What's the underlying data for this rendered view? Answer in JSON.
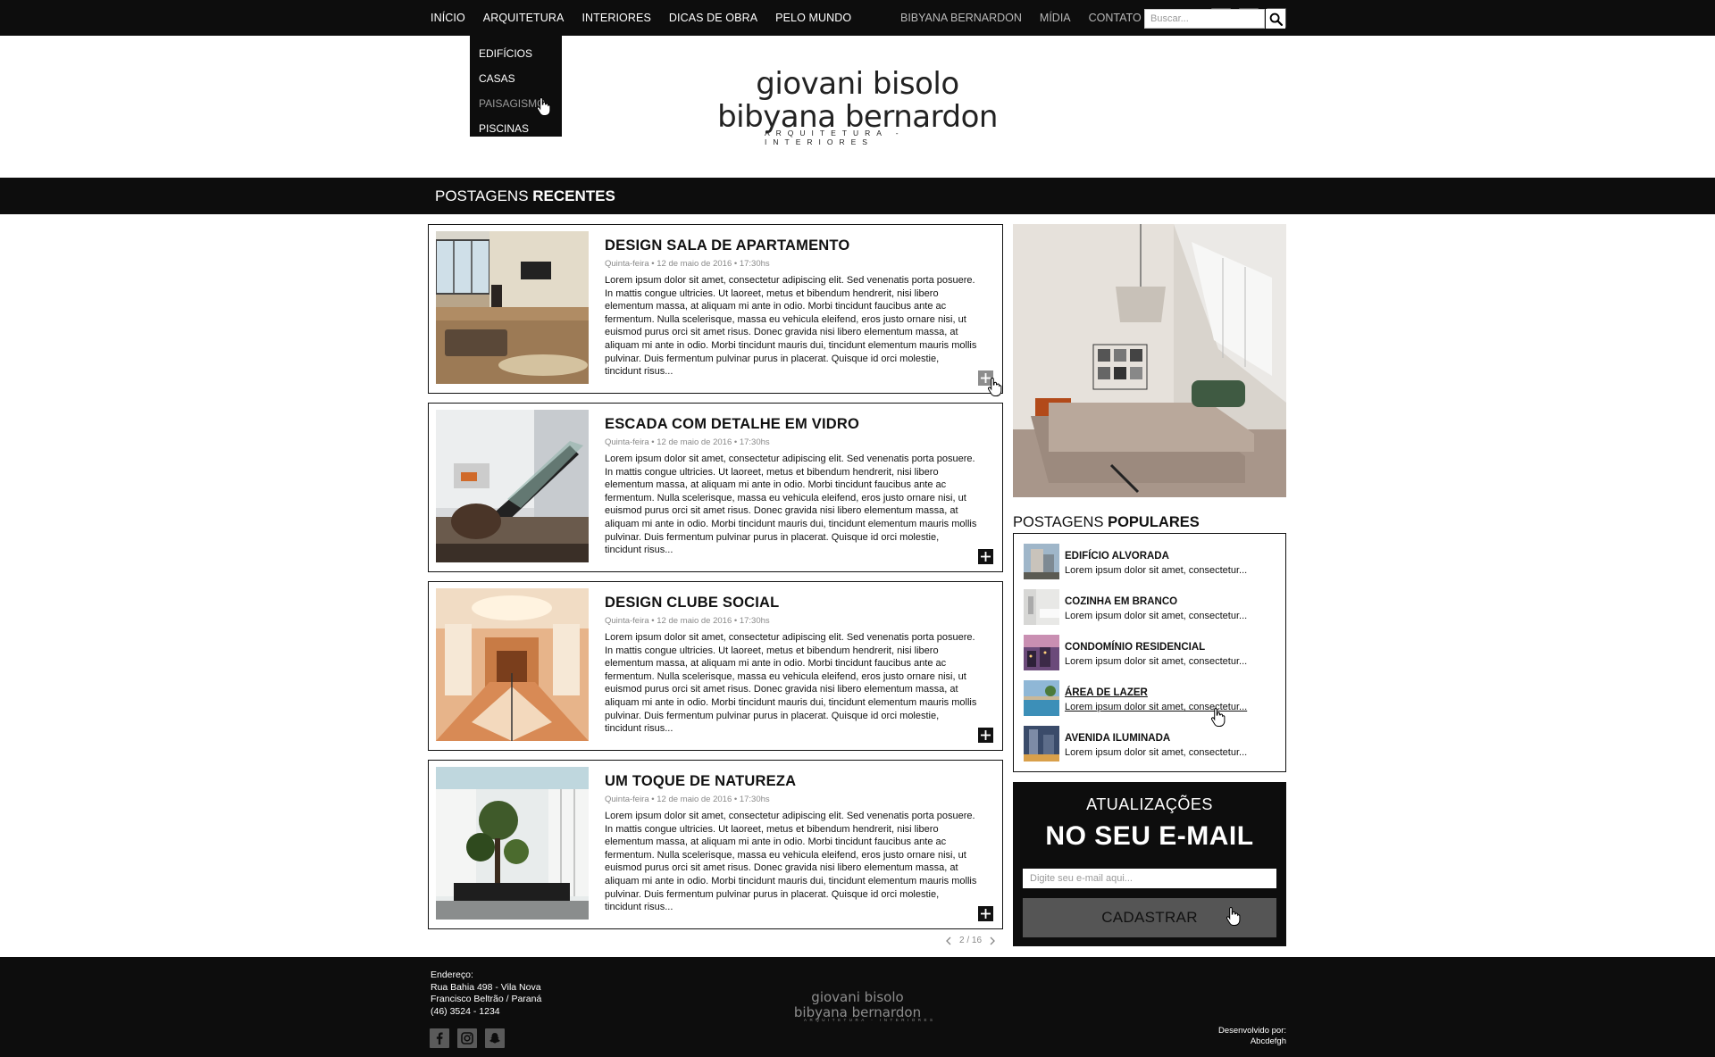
{
  "nav": {
    "main": [
      "INÍCIO",
      "ARQUITETURA",
      "INTERIORES",
      "DICAS DE OBRA",
      "PELO MUNDO"
    ],
    "secondary": [
      "BIBYANA BERNARDON",
      "MÍDIA",
      "CONTATO"
    ],
    "social": [
      "facebook-icon",
      "instagram-icon",
      "snapchat-icon"
    ]
  },
  "dropdown": {
    "items": [
      "EDIFÍCIOS",
      "CASAS",
      "PAISAGISMO",
      "PISCINAS"
    ],
    "hovered": "PAISAGISMO"
  },
  "logo": {
    "line1": "giovani bisolo",
    "line2": "bibyana bernardon",
    "tagline": "ARQUITETURA - INTERIORES"
  },
  "section": {
    "title_light": "POSTAGENS ",
    "title_bold": "RECENTES",
    "search_placeholder": "Buscar..."
  },
  "posts": [
    {
      "title": "DESIGN SALA DE APARTAMENTO",
      "date": "Quinta-feira • 12 de maio de 2016 • 17:30hs",
      "excerpt": "Lorem ipsum dolor sit amet, consectetur adipiscing elit. Sed venenatis porta posuere. In mattis congue ultricies. Ut laoreet, metus et bibendum hendrerit, nisi libero elementum massa, at aliquam mi ante in odio. Morbi tincidunt faucibus ante ac fermentum. Nulla scelerisque, massa eu vehicula eleifend, eros justo ornare nisi, ut euismod purus orci sit amet risus. Donec gravida nisi libero elementum massa, at aliquam mi ante in odio. Morbi tincidunt mauris dui, tincidunt elementum mauris mollis pulvinar. Duis fermentum pulvinar purus in placerat. Quisque id orci molestie, tincidunt risus..."
    },
    {
      "title": "ESCADA COM DETALHE EM VIDRO",
      "date": "Quinta-feira • 12 de maio de 2016 • 17:30hs",
      "excerpt": "Lorem ipsum dolor sit amet, consectetur adipiscing elit. Sed venenatis porta posuere. In mattis congue ultricies. Ut laoreet, metus et bibendum hendrerit, nisi libero elementum massa, at aliquam mi ante in odio. Morbi tincidunt faucibus ante ac fermentum. Nulla scelerisque, massa eu vehicula eleifend, eros justo ornare nisi, ut euismod purus orci sit amet risus. Donec gravida nisi libero elementum massa, at aliquam mi ante in odio. Morbi tincidunt mauris dui, tincidunt elementum mauris mollis pulvinar. Duis fermentum pulvinar purus in placerat. Quisque id orci molestie, tincidunt risus..."
    },
    {
      "title": "DESIGN CLUBE SOCIAL",
      "date": "Quinta-feira • 12 de maio de 2016 • 17:30hs",
      "excerpt": "Lorem ipsum dolor sit amet, consectetur adipiscing elit. Sed venenatis porta posuere. In mattis congue ultricies. Ut laoreet, metus et bibendum hendrerit, nisi libero elementum massa, at aliquam mi ante in odio. Morbi tincidunt faucibus ante ac fermentum. Nulla scelerisque, massa eu vehicula eleifend, eros justo ornare nisi, ut euismod purus orci sit amet risus. Donec gravida nisi libero elementum massa, at aliquam mi ante in odio. Morbi tincidunt mauris dui, tincidunt elementum mauris mollis pulvinar. Duis fermentum pulvinar purus in placerat. Quisque id orci molestie, tincidunt risus..."
    },
    {
      "title": "UM TOQUE DE NATUREZA",
      "date": "Quinta-feira • 12 de maio de 2016 • 17:30hs",
      "excerpt": "Lorem ipsum dolor sit amet, consectetur adipiscing elit. Sed venenatis porta posuere. In mattis congue ultricies. Ut laoreet, metus et bibendum hendrerit, nisi libero elementum massa, at aliquam mi ante in odio. Morbi tincidunt faucibus ante ac fermentum. Nulla scelerisque, massa eu vehicula eleifend, eros justo ornare nisi, ut euismod purus orci sit amet risus. Donec gravida nisi libero elementum massa, at aliquam mi ante in odio. Morbi tincidunt mauris dui, tincidunt elementum mauris mollis pulvinar. Duis fermentum pulvinar purus in placerat. Quisque id orci molestie, tincidunt risus..."
    }
  ],
  "pagination": {
    "label": "2 / 16"
  },
  "popular": {
    "title_light": "POSTAGENS ",
    "title_bold": "POPULARES",
    "items": [
      {
        "name": "EDIFÍCIO ALVORADA",
        "desc": "Lorem ipsum dolor sit amet, consectetur..."
      },
      {
        "name": "COZINHA EM BRANCO",
        "desc": "Lorem ipsum dolor sit amet, consectetur..."
      },
      {
        "name": "CONDOMÍNIO RESIDENCIAL",
        "desc": "Lorem ipsum dolor sit amet, consectetur..."
      },
      {
        "name": "ÁREA DE LAZER",
        "desc": "Lorem ipsum dolor sit amet, consectetur..."
      },
      {
        "name": "AVENIDA ILUMINADA",
        "desc": "Lorem ipsum dolor sit amet, consectetur..."
      }
    ]
  },
  "newsletter": {
    "line1": "ATUALIZAÇÕES",
    "line2": "NO SEU E-MAIL",
    "placeholder": "Digite seu e-mail aqui...",
    "button": "CADASTRAR"
  },
  "footer": {
    "address_label": "Endereço:",
    "address_line1": "Rua Bahia 498 - Vila Nova",
    "address_line2": "Francisco Beltrão / Paraná",
    "phone": "(46) 3524 - 1234",
    "logo_line1": "giovani bisolo",
    "logo_line2": "bibyana bernardon",
    "logo_tagline": "ARQUITETURA - INTERIORES",
    "credit_label": "Desenvolvido por:",
    "credit_name": "Abcdefgh"
  },
  "colors": {
    "dark": "#0d0d0d",
    "muted": "#8a8a8a",
    "button": "#555555"
  }
}
